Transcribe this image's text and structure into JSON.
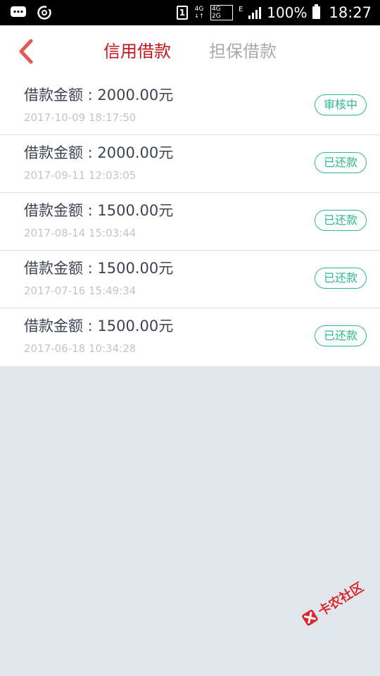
{
  "status_bar": {
    "sim": "1",
    "network_top": "4G",
    "network_top_sub": "4G",
    "network_bottom_sub": "2G",
    "network_e": "E",
    "battery": "100%",
    "time": "18:27"
  },
  "header": {
    "tabs": [
      {
        "label": "信用借款"
      },
      {
        "label": "担保借款"
      }
    ]
  },
  "loans": [
    {
      "amount": "借款金额 : 2000.00元",
      "date": "2017-10-09 18:17:50",
      "status": "审核中"
    },
    {
      "amount": "借款金额 : 2000.00元",
      "date": "2017-09-11 12:03:05",
      "status": "已还款"
    },
    {
      "amount": "借款金额 : 1500.00元",
      "date": "2017-08-14 15:03:44",
      "status": "已还款"
    },
    {
      "amount": "借款金额 : 1500.00元",
      "date": "2017-07-16 15:49:34",
      "status": "已还款"
    },
    {
      "amount": "借款金额 : 1500.00元",
      "date": "2017-06-18 10:34:28",
      "status": "已还款"
    }
  ],
  "watermark": {
    "text": "卡农社区"
  },
  "colors": {
    "accent": "#c8151d",
    "status_green": "#2cb98a",
    "background": "#e1e6ec"
  }
}
